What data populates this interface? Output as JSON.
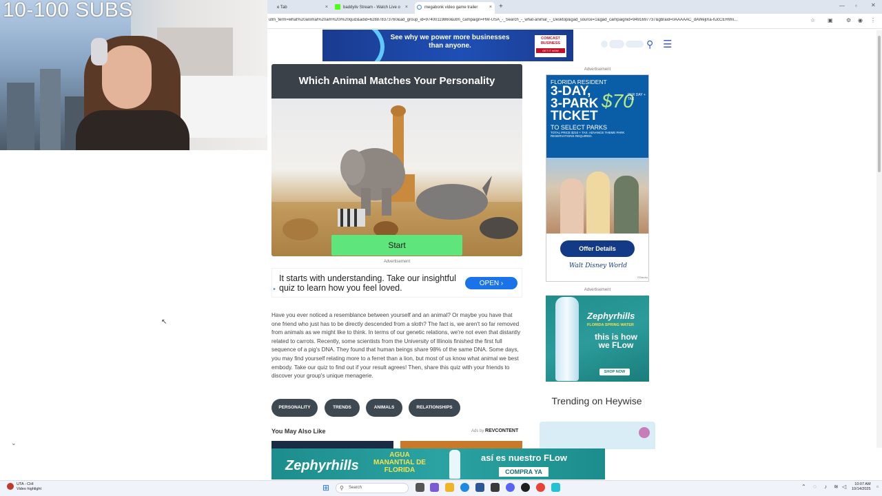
{
  "overlay": {
    "subs_text": "10-100 SUBS"
  },
  "browser": {
    "tabs": [
      {
        "label": "e Tab",
        "close": "×"
      },
      {
        "label": "baddyliv Stream - Watch Live o",
        "close": "×"
      },
      {
        "label": "megabonk video game trailer",
        "close": "×"
      }
    ],
    "new_tab": "+",
    "url": "utm_term=what%20animal%20am%20i%20quiz&adid=628878373760&ad_group_id=97400119860&utm_campaign=HW-USA_-_Search_-_what-animal_-_Desktop&gad_source=1&gad_campaignid=9491697737&gbraid=0AAAAAC_dAWejlXa-hJcCEHWx..."
  },
  "ads": {
    "top": {
      "headline": "See why we power more businesses than anyone.",
      "brand_line1": "COMCAST",
      "brand_line2": "BUSINESS",
      "cta": "GET IT NOW"
    },
    "label": "Advertisement",
    "mid": {
      "text": "It starts with understanding. Take our insightful quiz to learn how you feel loved.",
      "cta": "OPEN"
    },
    "disney": {
      "line1": "FLORIDA RESIDENT",
      "line2": "3-DAY,",
      "line3": "3-PARK",
      "line4": "TICKET",
      "price": "$70",
      "price_note": "PER DAY + TAX",
      "line5": "TO SELECT PARKS",
      "fine": "TOTAL PRICE $210 + TAX. ADVANCE THEME PARK RESERVATIONS REQUIRED.",
      "cta": "Offer Details",
      "brand": "Walt Disney World",
      "copyright": "©Disney"
    },
    "zephyr_side": {
      "brand": "Zephyrhills",
      "tagline": "FLORIDA SPRING WATER",
      "slogan": "this is how we FLow",
      "cta": "SHOP NOW"
    },
    "zephyr_bottom": {
      "brand": "Zephyrhills",
      "tagline": "AGUA MANANTIAL DE FLORIDA",
      "slogan": "así es nuestro FLow",
      "cta": "COMPRA YA"
    }
  },
  "quiz": {
    "title": "Which Animal Matches Your Personality",
    "start_label": "Start"
  },
  "article": {
    "body": "Have you ever noticed a resemblance between yourself and an animal? Or maybe you have that one friend who just has to be directly descended from a sloth? The fact is, we aren't so far removed from animals as we might like to think. In terms of our genetic relations, we're not even that distantly related to carrots. Recently, some scientists from the University of Illinois finished the first full sequence of a pig's DNA. They found that human beings share 98% of the same DNA. Some days, you may find yourself relating more to a ferret than a lion, but most of us know what animal we best embody. Take our quiz to find out if your result agrees! Then, share this quiz with your friends to discover your group's unique menagerie."
  },
  "tags": [
    "PERSONALITY",
    "TRENDS",
    "ANIMALS",
    "RELATIONSHIPS"
  ],
  "recommend": {
    "title": "You May Also Like",
    "ads_by": "Ads by",
    "provider": "REVCONTENT"
  },
  "sidebar": {
    "trending_title": "Trending on Heywise"
  },
  "taskbar": {
    "weather_line1": "UTA - CHI",
    "weather_line2": "Video highlight",
    "search_placeholder": "Search",
    "time": "10:07 AM",
    "date": "10/14/2025"
  },
  "colors": {
    "start_button": "#5ee67c",
    "quiz_header": "#3b4148",
    "tag_chip": "#3d4850",
    "open_button": "#1a73e8",
    "offer_button": "#123a86"
  }
}
